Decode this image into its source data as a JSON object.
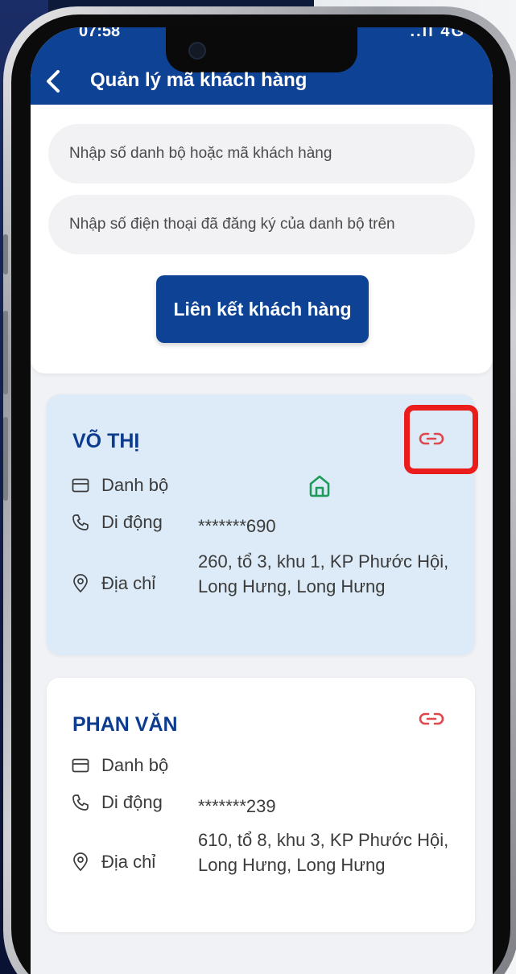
{
  "status_bar": {
    "time": "07:58",
    "icons": "..ll 4G"
  },
  "header": {
    "title": "Quản lý mã khách hàng"
  },
  "form": {
    "code_placeholder": "Nhập số danh bộ hoặc mã khách hàng",
    "phone_placeholder": "Nhập số điện thoại đã đăng ký của danh bộ trên",
    "link_button_label": "Liên kết khách hàng"
  },
  "customers": [
    {
      "name": "VÕ THỊ",
      "account_label": "Danh bộ",
      "mobile_label": "Di động",
      "mobile_value": "*******690",
      "address_label": "Địa chỉ",
      "address_value": "260, tổ 3, khu 1, KP Phước Hội, Long Hưng, Long Hưng"
    },
    {
      "name": "PHAN VĂN",
      "account_label": "Danh bộ",
      "mobile_label": "Di động",
      "mobile_value": "*******239",
      "address_label": "Địa chỉ",
      "address_value": "610, tổ 8, khu 3, KP Phước Hội, Long Hưng, Long Hưng"
    }
  ],
  "colors": {
    "header_blue": "#0d4294",
    "name_blue": "#0d3b8e",
    "link_icon_red": "#e0474c",
    "home_icon_green": "#1e9b5a",
    "highlight_red": "#ea1c1c",
    "selected_card_bg": "#dcebf7"
  },
  "icons": {
    "back": "chevron-left-icon",
    "link": "link-chain-icon",
    "account": "card-icon",
    "phone": "phone-icon",
    "address": "location-pin-icon",
    "home": "home-icon"
  }
}
